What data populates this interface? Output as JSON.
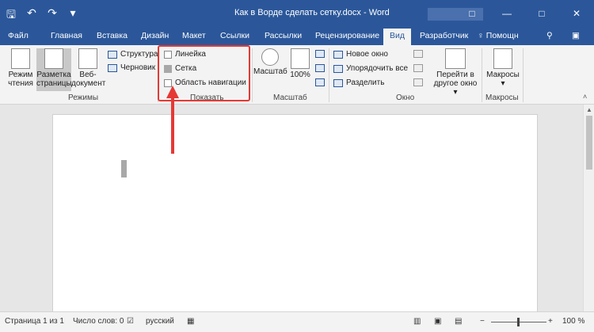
{
  "title_bar": {
    "qat_icons": [
      "save-icon",
      "undo-icon",
      "redo-icon",
      "customize-icon"
    ],
    "save_glyph": "🖫",
    "undo_glyph": "↶",
    "redo_glyph": "↷",
    "more_glyph": "▾",
    "title": "Как в Ворде сделать сетку.docx - Word",
    "win_buttons": [
      "□",
      "—",
      "□",
      "✕"
    ]
  },
  "tabs": {
    "file": "Файл",
    "home": "Главная",
    "insert": "Вставка",
    "design": "Дизайн",
    "layout": "Макет",
    "references": "Ссылки",
    "mailings": "Рассылки",
    "review": "Рецензирование",
    "view": "Вид",
    "developer": "Разработчик",
    "tell_me": "♀ Помощн",
    "share": "⚲",
    "comments": "▣"
  },
  "ribbon": {
    "modes": {
      "read_mode": "Режим\nчтения",
      "read_mode_1": "Режим",
      "read_mode_2": "чтения",
      "print_layout_1": "Разметка",
      "print_layout_2": "страницы",
      "web_1": "Веб-",
      "web_2": "документ",
      "outline": "Структура",
      "draft": "Черновик",
      "group_label": "Режимы"
    },
    "show": {
      "ruler": "Линейка",
      "gridlines": "Сетка",
      "nav_pane": "Область навигации",
      "group_label": "Показать"
    },
    "zoom": {
      "zoom": "Масштаб",
      "hundred": "100%",
      "group_label": "Масштаб"
    },
    "window": {
      "new_window": "Новое окно",
      "arrange_all": "Упорядочить все",
      "split": "Разделить",
      "switch_1": "Перейти в",
      "switch_2": "другое окно ▾",
      "group_label": "Окно"
    },
    "macros": {
      "macros": "Макросы",
      "group_label": "Макросы"
    }
  },
  "status_bar": {
    "page": "Страница 1 из 1",
    "words": "Число слов: 0",
    "language": "русский",
    "zoom_minus": "−",
    "zoom_plus": "+",
    "zoom": "100 %"
  },
  "colors": {
    "accent": "#2b579a",
    "highlight": "#e53935"
  }
}
